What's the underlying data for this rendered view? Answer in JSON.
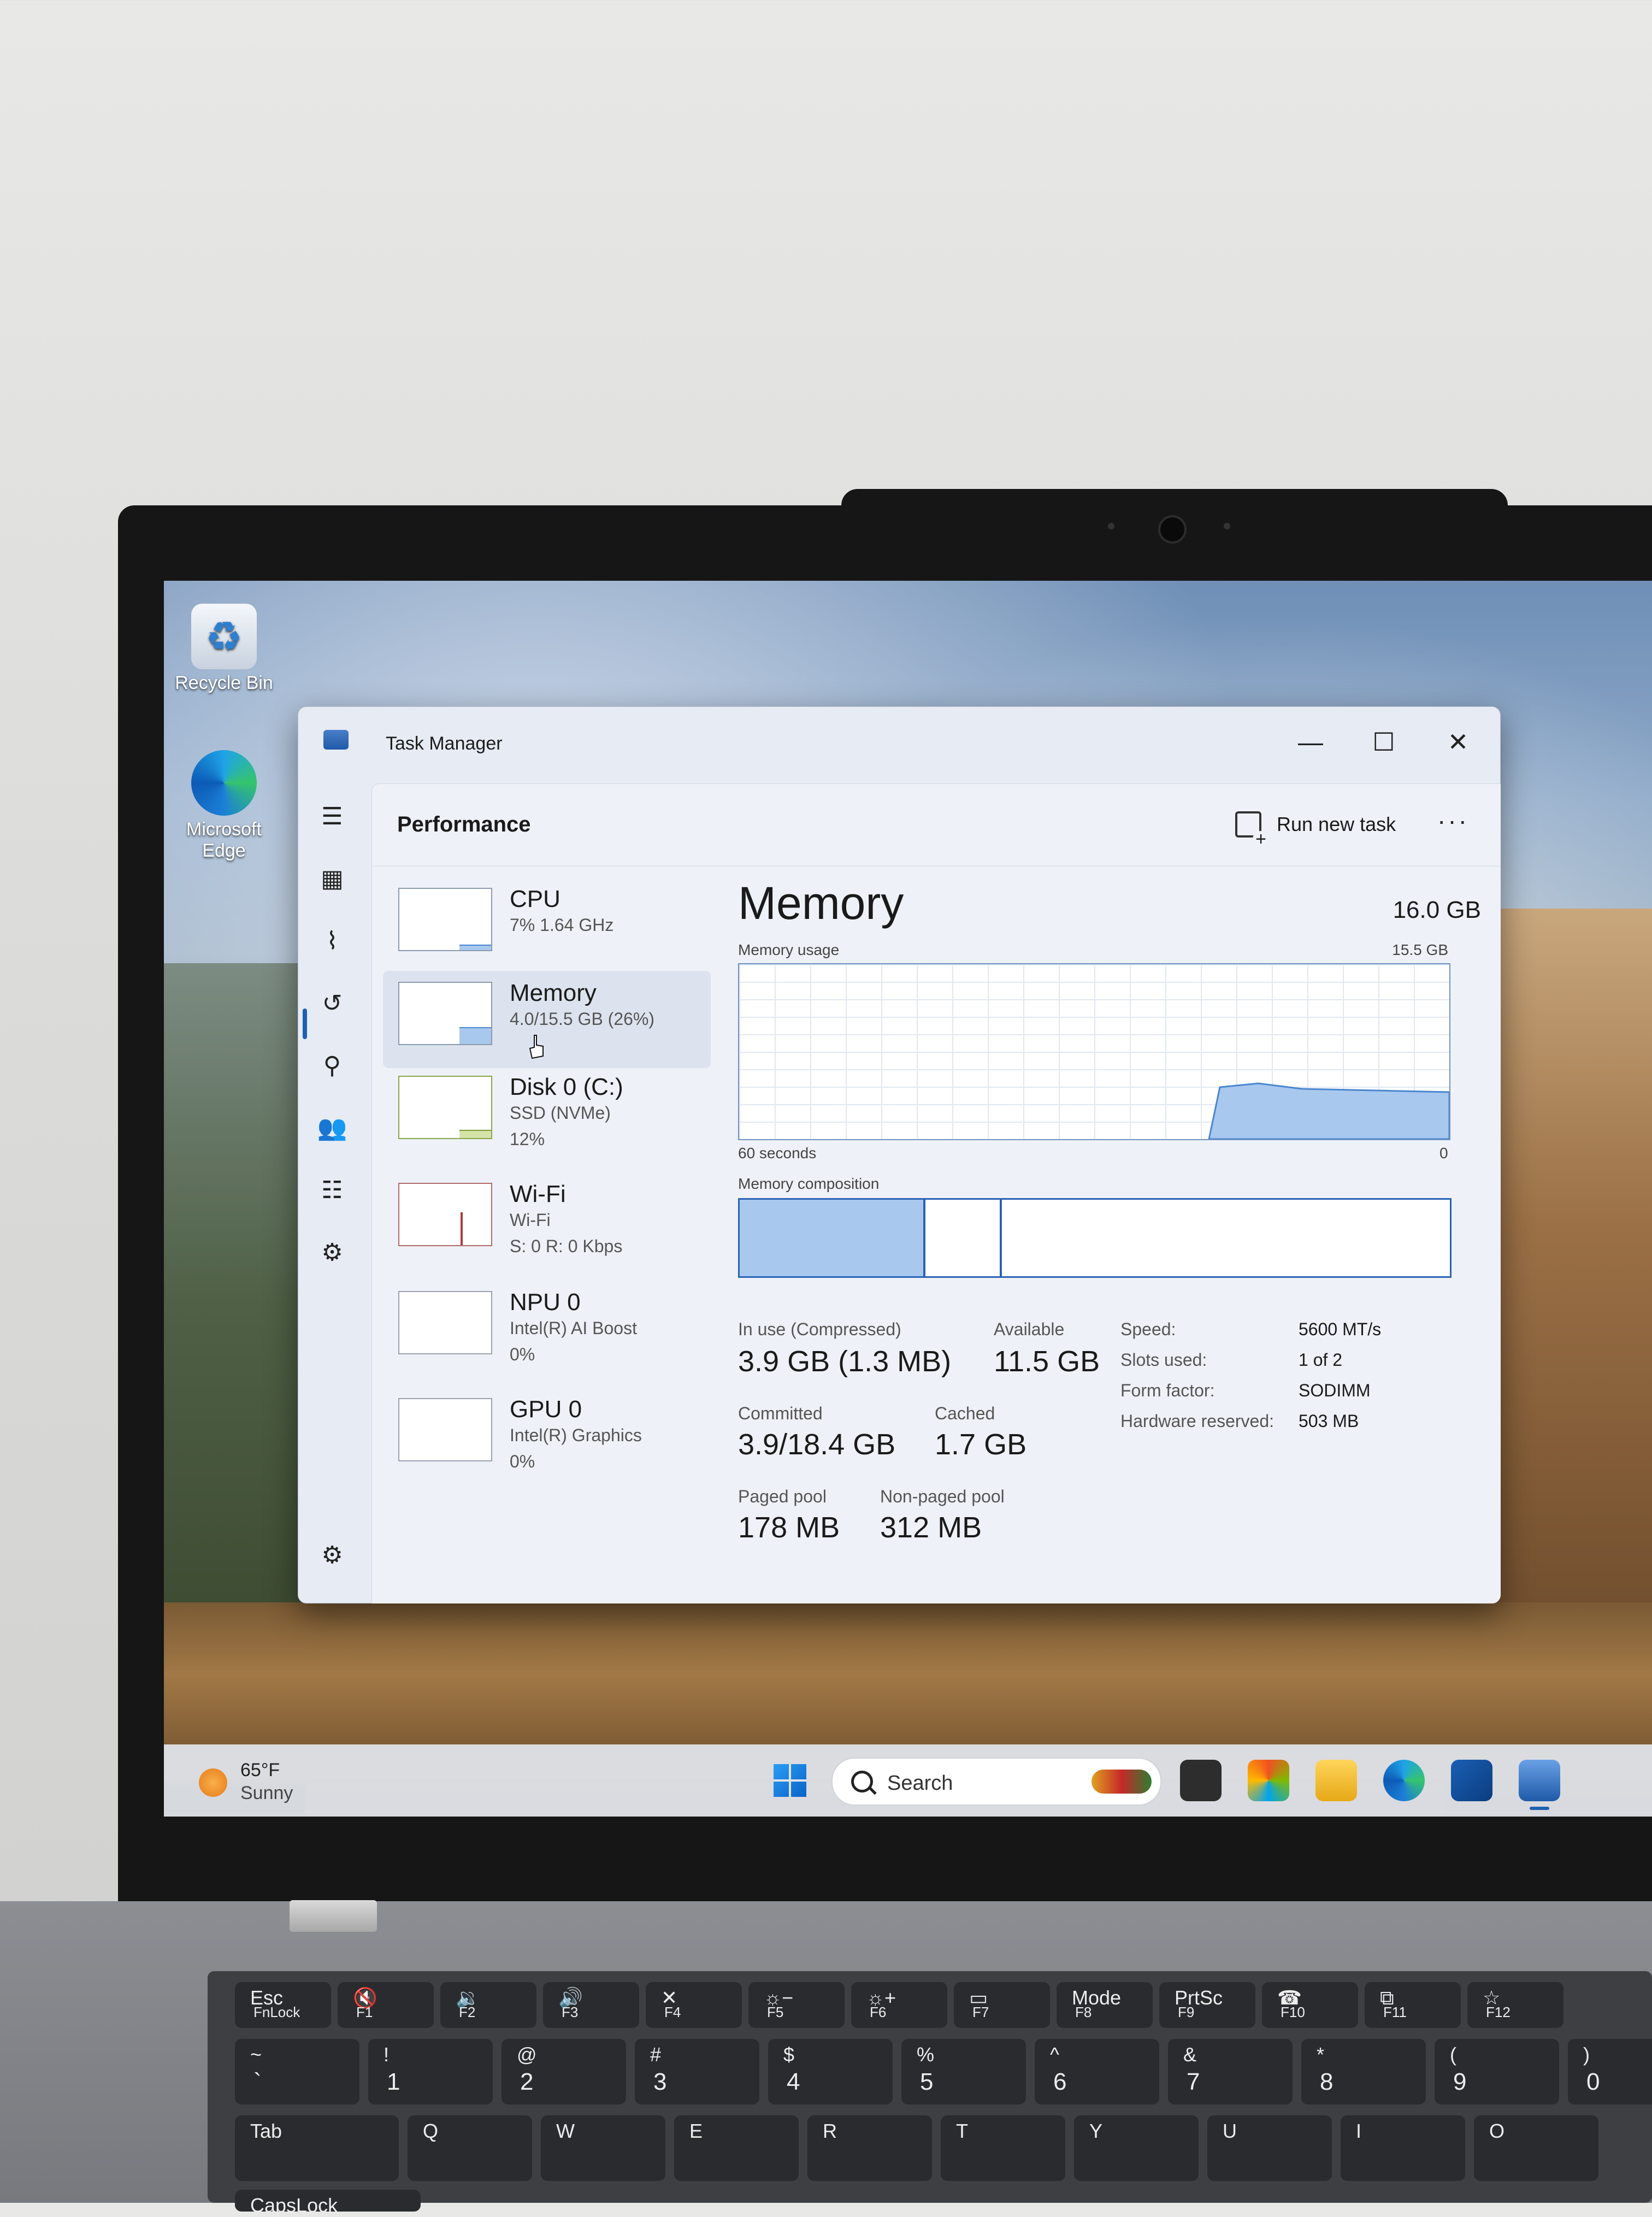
{
  "desktop": {
    "icons": [
      {
        "label": "Recycle Bin"
      },
      {
        "label": "Microsoft Edge"
      }
    ]
  },
  "window": {
    "title": "Task Manager",
    "controls": {
      "minimize": "—",
      "maximize": "☐",
      "close": "✕"
    }
  },
  "nav": {
    "icons": [
      "hamburger-icon",
      "processes-icon",
      "performance-icon",
      "app-history-icon",
      "startup-apps-icon",
      "users-icon",
      "details-icon",
      "services-icon",
      "settings-icon"
    ]
  },
  "header": {
    "title": "Performance",
    "run_new_task": "Run new task",
    "more": "···"
  },
  "devices": [
    {
      "name": "CPU",
      "line1": "7%  1.64 GHz",
      "line2": "",
      "fill": 0.07
    },
    {
      "name": "Memory",
      "line1": "4.0/15.5 GB (26%)",
      "line2": "",
      "fill": 0.26
    },
    {
      "name": "Disk 0 (C:)",
      "line1": "SSD (NVMe)",
      "line2": "12%",
      "fill": 0.12
    },
    {
      "name": "Wi-Fi",
      "line1": "Wi-Fi",
      "line2": "S: 0  R: 0 Kbps",
      "fill": 0.0
    },
    {
      "name": "NPU 0",
      "line1": "Intel(R) AI Boost",
      "line2": "0%",
      "fill": 0.0
    },
    {
      "name": "GPU 0",
      "line1": "Intel(R) Graphics",
      "line2": "0%",
      "fill": 0.0
    }
  ],
  "memory": {
    "title": "Memory",
    "total": "16.0 GB",
    "usage_label": "Memory usage",
    "usage_max": "15.5 GB",
    "graph_left": "60 seconds",
    "graph_right": "0",
    "usage_fraction": 0.26,
    "composition_label": "Memory composition",
    "stats": {
      "in_use_label": "In use (Compressed)",
      "in_use_value": "3.9 GB (1.3 MB)",
      "available_label": "Available",
      "available_value": "11.5 GB",
      "committed_label": "Committed",
      "committed_value": "3.9/18.4 GB",
      "cached_label": "Cached",
      "cached_value": "1.7 GB",
      "paged_label": "Paged pool",
      "paged_value": "178 MB",
      "nonpaged_label": "Non-paged pool",
      "nonpaged_value": "312 MB"
    },
    "specs": [
      {
        "label": "Speed:",
        "value": "5600 MT/s"
      },
      {
        "label": "Slots used:",
        "value": "1 of 2"
      },
      {
        "label": "Form factor:",
        "value": "SODIMM"
      },
      {
        "label": "Hardware reserved:",
        "value": "503 MB"
      }
    ]
  },
  "taskbar": {
    "weather_temp": "65°F",
    "weather_desc": "Sunny",
    "search_placeholder": "Search"
  },
  "keyboard": {
    "fn_row": [
      {
        "top": "Esc",
        "bottom": "FnLock"
      },
      {
        "top": "🔇",
        "bottom": "F1"
      },
      {
        "top": "🔉",
        "bottom": "F2"
      },
      {
        "top": "🔊",
        "bottom": "F3"
      },
      {
        "top": "✕",
        "bottom": "F4"
      },
      {
        "top": "☼−",
        "bottom": "F5"
      },
      {
        "top": "☼+",
        "bottom": "F6"
      },
      {
        "top": "▭",
        "bottom": "F7"
      },
      {
        "top": "Mode",
        "bottom": "F8"
      },
      {
        "top": "PrtSc",
        "bottom": "F9"
      },
      {
        "top": "☎",
        "bottom": "F10"
      },
      {
        "top": "⧉",
        "bottom": "F11"
      },
      {
        "top": "☆",
        "bottom": "F12"
      }
    ],
    "num_row": [
      {
        "top": "~",
        "bottom": "`"
      },
      {
        "top": "!",
        "bottom": "1"
      },
      {
        "top": "@",
        "bottom": "2"
      },
      {
        "top": "#",
        "bottom": "3"
      },
      {
        "top": "$",
        "bottom": "4"
      },
      {
        "top": "%",
        "bottom": "5"
      },
      {
        "top": "^",
        "bottom": "6"
      },
      {
        "top": "&",
        "bottom": "7"
      },
      {
        "top": "*",
        "bottom": "8"
      },
      {
        "top": "(",
        "bottom": "9"
      },
      {
        "top": ")",
        "bottom": "0"
      }
    ],
    "top_row": [
      "Tab",
      "Q",
      "W",
      "E",
      "R",
      "T",
      "Y",
      "U",
      "I",
      "O"
    ],
    "caps": "CapsLock"
  }
}
